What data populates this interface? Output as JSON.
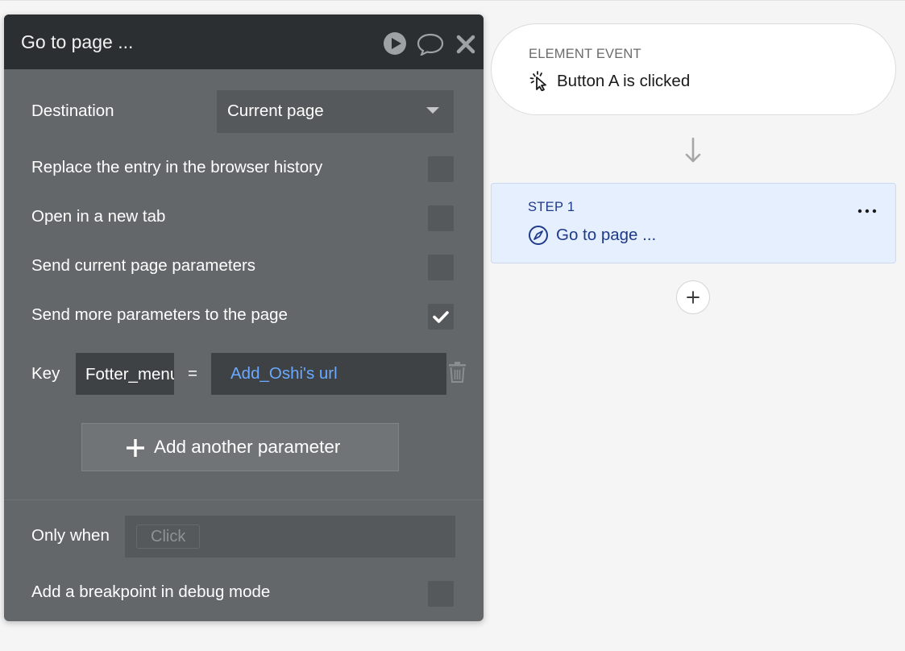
{
  "panel": {
    "title": "Go to page ...",
    "destination": {
      "label": "Destination",
      "value": "Current page"
    },
    "options": [
      {
        "label": "Replace the entry in the browser history",
        "checked": false
      },
      {
        "label": "Open in a new tab",
        "checked": false
      },
      {
        "label": "Send current page parameters",
        "checked": false
      },
      {
        "label": "Send more parameters to the page",
        "checked": true
      }
    ],
    "param": {
      "key_label": "Key",
      "key_value": "Fotter_menu",
      "equals": "=",
      "value": "Add_Oshi's url"
    },
    "add_param_label": "Add another parameter",
    "only_when": {
      "label": "Only when",
      "placeholder": "Click"
    },
    "breakpoint": {
      "label": "Add a breakpoint in debug mode",
      "checked": false
    }
  },
  "workflow": {
    "event": {
      "type": "ELEMENT EVENT",
      "title": "Button A is clicked",
      "icon": "cursor-click-icon"
    },
    "step": {
      "label": "STEP 1",
      "title": "Go to page ...",
      "icon": "compass-icon"
    }
  },
  "colors": {
    "panel_bg": "#636769",
    "panel_header": "#2b2f31",
    "link_blue": "#6aa9ff",
    "step_bg": "#e6effd",
    "step_text": "#1e3a8a"
  }
}
